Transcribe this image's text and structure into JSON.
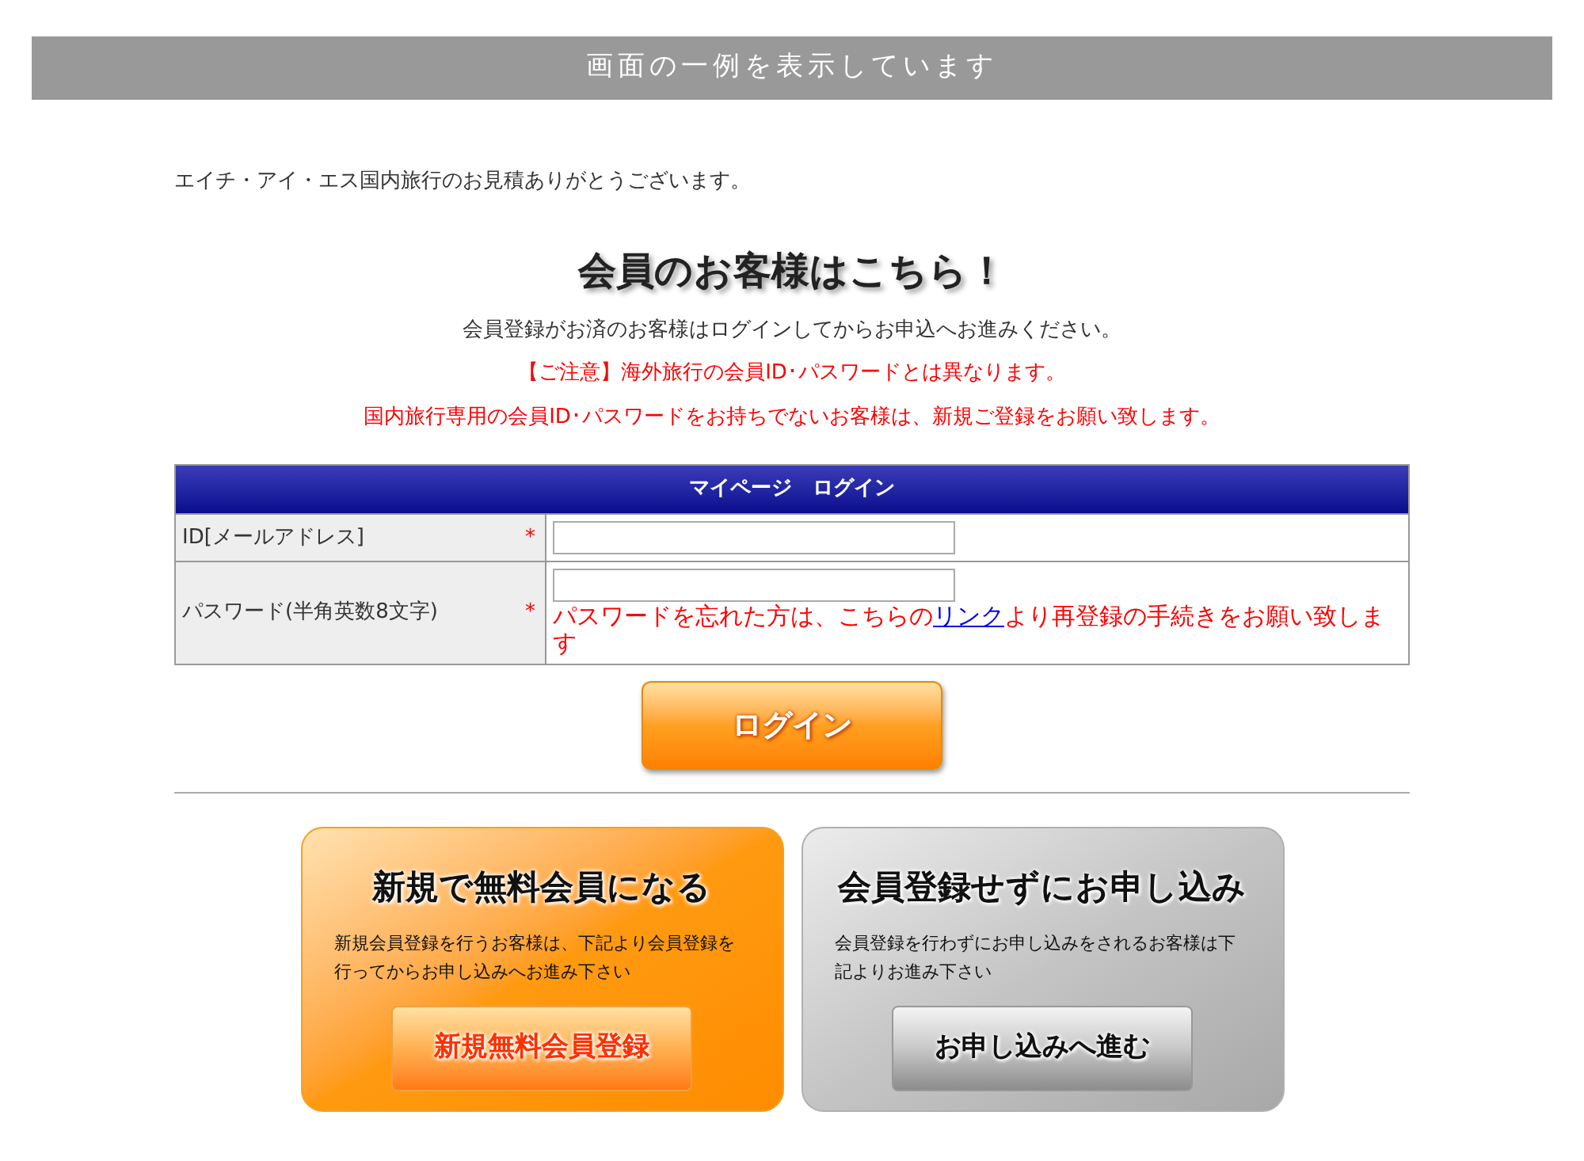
{
  "banner": "画面の一例を表示しています",
  "greeting": "エイチ・アイ・エス国内旅行のお見積ありがとうございます。",
  "member_heading": "会員のお客様はこちら！",
  "messages": [
    {
      "text": "会員登録がお済のお客様はログインしてからお申込へお進みください。",
      "kind": "info"
    },
    {
      "text": "【ご注意】海外旅行の会員ID･パスワードとは異なります。",
      "kind": "warning"
    },
    {
      "text": "国内旅行専用の会員ID･パスワードをお持ちでないお客様は、新規ご登録をお願い致します。",
      "kind": "warning"
    }
  ],
  "login_form": {
    "title": "マイページ　ログイン",
    "fields": [
      {
        "label": "ID[メールアドレス]",
        "required_mark": "*"
      },
      {
        "label": "パスワード(半角英数8文字)",
        "required_mark": "*",
        "note": {
          "before": "パスワードを忘れた方は、こちらの",
          "link": "リンク",
          "after": "より再登録の手続きをお願い致します"
        }
      }
    ],
    "button": "ログイン"
  },
  "cards": [
    {
      "kind": "member",
      "title": "新規で無料会員になる",
      "text": "新規会員登録を行うお客様は、下記より会員登録を行ってからお申し込みへお進み下さい",
      "button": "新規無料会員登録"
    },
    {
      "kind": "guest",
      "title": "会員登録せずにお申し込み",
      "text": "会員登録を行わずにお申し込みをされるお客様は下記よりお進み下さい",
      "button": "お申し込みへ進む"
    }
  ]
}
